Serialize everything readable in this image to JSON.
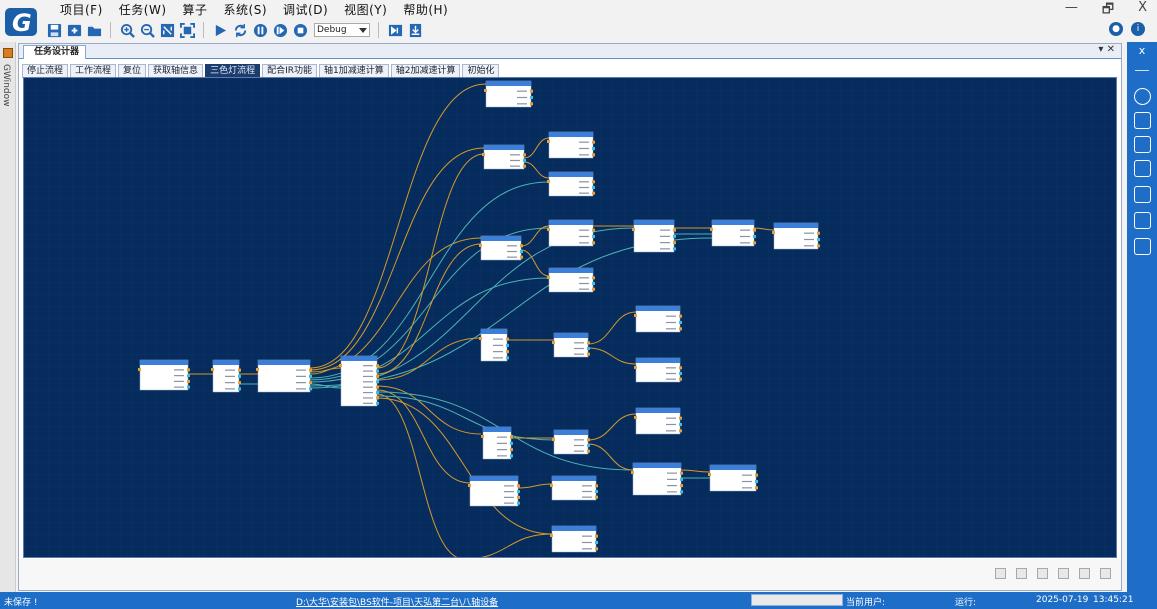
{
  "app": {
    "logo_text": "G",
    "window_controls": [
      "—",
      "🗗",
      "X"
    ]
  },
  "menu": [
    {
      "label": "项目(F)"
    },
    {
      "label": "任务(W)"
    },
    {
      "label": "算子"
    },
    {
      "label": "系统(S)"
    },
    {
      "label": "调试(D)"
    },
    {
      "label": "视图(Y)"
    },
    {
      "label": "帮助(H)"
    }
  ],
  "toolbar": {
    "icons": [
      "save-icon",
      "add-icon",
      "open-folder-icon",
      "zoom-in-icon",
      "zoom-out-icon",
      "fit-icon",
      "fullscreen-icon",
      "run-icon",
      "loop-icon",
      "pause-icon",
      "step-icon",
      "stop-icon",
      "step-into-icon",
      "download-icon"
    ],
    "mode_value": "Debug"
  },
  "left_dock": {
    "label": "GWindow"
  },
  "document": {
    "tab_title": "任务设计器",
    "tab_controls": "▾ ✕"
  },
  "subtabs": [
    {
      "label": "停止流程",
      "active": false
    },
    {
      "label": "工作流程",
      "active": false
    },
    {
      "label": "复位",
      "active": false
    },
    {
      "label": "获取轴信息",
      "active": false
    },
    {
      "label": "三色灯流程",
      "active": true
    },
    {
      "label": "配合IR功能",
      "active": false
    },
    {
      "label": "轴1加减速计算",
      "active": false
    },
    {
      "label": "轴2加减速计算",
      "active": false
    },
    {
      "label": "初始化",
      "active": false
    }
  ],
  "canvas": {
    "background": "#062b5d",
    "wire_colors": {
      "flow": "#d79a28",
      "signal": "#4fb3b3"
    }
  },
  "status": {
    "save_state": "未保存 !",
    "project_path": "D:\\大华\\安装包\\BS软件-项目\\天弘第二台\\八轴设备",
    "current_user_label": "当前用户:",
    "running_label": "运行:",
    "date": "2025-07-19",
    "time": "13:45:21"
  }
}
